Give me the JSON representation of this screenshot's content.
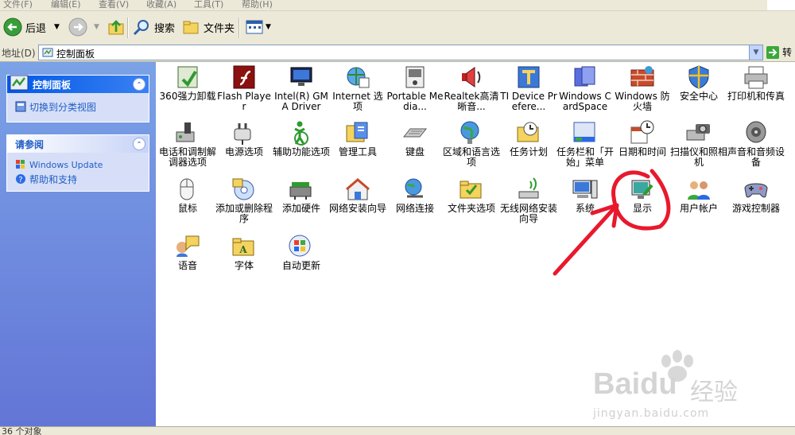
{
  "menu": [
    "文件(F)",
    "编辑(E)",
    "查看(V)",
    "收藏(A)",
    "工具(T)",
    "帮助(H)"
  ],
  "toolbar": {
    "back_label": "后退",
    "search_label": "搜索",
    "folders_label": "文件夹"
  },
  "address": {
    "label": "地址(D)",
    "value": "控制面板",
    "go_label": "转"
  },
  "left": {
    "panel1": {
      "title": "控制面板",
      "link": "切换到分类视图"
    },
    "panel2": {
      "title": "请参阅",
      "links": [
        "Windows Update",
        "帮助和支持"
      ]
    }
  },
  "items": [
    [
      "360强力卸载",
      "Flash Player",
      "Intel(R) GMA Driver",
      "Internet 选项",
      "Portable Media...",
      "Realtek高清晰音...",
      "TI Device Prefere...",
      "Windows CardSpace",
      "Windows 防火墙",
      "安全中心",
      "打印机和传真"
    ],
    [
      "电话和调制解调器选项",
      "电源选项",
      "辅助功能选项",
      "管理工具",
      "键盘",
      "区域和语言选项",
      "任务计划",
      "任务栏和「开始」菜单",
      "日期和时间",
      "扫描仪和照相机",
      "声音和音频设备"
    ],
    [
      "鼠标",
      "添加或删除程序",
      "添加硬件",
      "网络安装向导",
      "网络连接",
      "文件夹选项",
      "无线网络安装向导",
      "系统",
      "显示",
      "用户帐户",
      "游戏控制器"
    ],
    [
      "语音",
      "字体",
      "自动更新"
    ]
  ],
  "icon_names": [
    [
      "uninstall-icon",
      "flash-icon",
      "monitor-icon",
      "internet-globe-icon",
      "media-device-icon",
      "speaker-icon",
      "ti-device-icon",
      "cardspace-icon",
      "firewall-icon",
      "security-shield-icon",
      "printer-icon"
    ],
    [
      "phone-modem-icon",
      "power-plug-icon",
      "accessibility-icon",
      "admin-tools-icon",
      "keyboard-icon",
      "globe-icon",
      "task-folder-icon",
      "taskbar-icon",
      "clock-calendar-icon",
      "scanner-camera-icon",
      "sound-speaker-icon"
    ],
    [
      "mouse-icon",
      "add-remove-programs-icon",
      "add-hardware-icon",
      "network-house-icon",
      "network-globe-icon",
      "folder-options-icon",
      "wireless-icon",
      "system-computer-icon",
      "display-icon",
      "user-accounts-icon",
      "gamepad-icon"
    ],
    [
      "speech-icon",
      "fonts-folder-icon",
      "windows-update-icon"
    ]
  ],
  "status": {
    "text": "36 个对象"
  },
  "watermark": {
    "brand": "Baidu",
    "cn": "经验",
    "url": "jingyan.baidu.com"
  },
  "colors": {
    "accent": "#0058e6",
    "annotation": "#e8192c",
    "leftpane": "#6f8ce0"
  }
}
